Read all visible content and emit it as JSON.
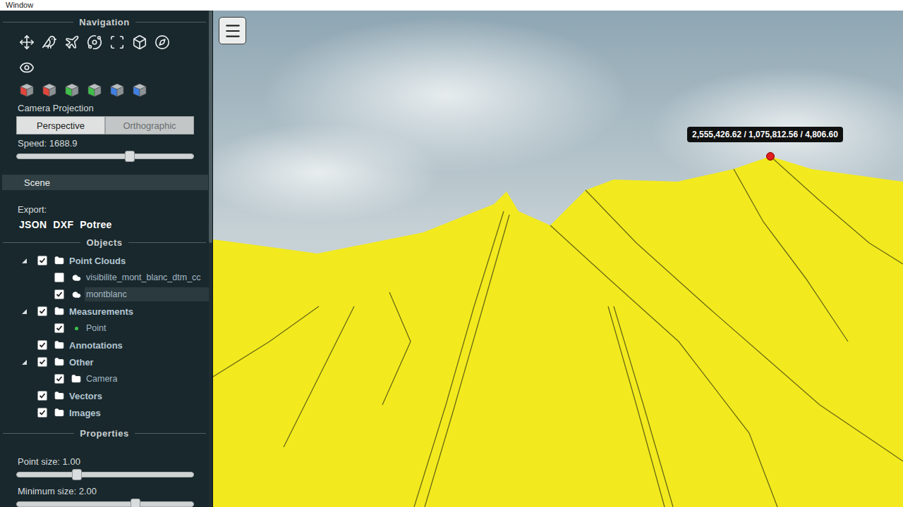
{
  "window": {
    "title": "Window"
  },
  "navigation": {
    "title": "Navigation",
    "view_cubes": [
      {
        "color": "#e0453c"
      },
      {
        "color": "#e0453c"
      },
      {
        "color": "#3fbf4a"
      },
      {
        "color": "#3fbf4a"
      },
      {
        "color": "#3f7fe0"
      },
      {
        "color": "#3f7fe0"
      }
    ],
    "camera_projection": {
      "label": "Camera Projection",
      "options": [
        {
          "label": "Perspective",
          "selected": true
        },
        {
          "label": "Orthographic",
          "selected": false
        }
      ]
    },
    "speed": {
      "label": "Speed: 1688.9",
      "level": 0.64
    }
  },
  "scene": {
    "title": "Scene",
    "export_label": "Export:",
    "export_formats": [
      "JSON",
      "DXF",
      "Potree"
    ]
  },
  "objects": {
    "title": "Objects",
    "tree": [
      {
        "label": "Point Clouds",
        "kind": "folder",
        "checked": true,
        "expanded": true,
        "selected": false,
        "children": [
          {
            "label": "visibilite_mont_blanc_dtm_cc",
            "kind": "pointcloud",
            "checked": false,
            "expanded": false,
            "selected": false,
            "children": []
          },
          {
            "label": "montblanc",
            "kind": "pointcloud",
            "checked": true,
            "expanded": false,
            "selected": true,
            "children": []
          }
        ]
      },
      {
        "label": "Measurements",
        "kind": "folder",
        "checked": true,
        "expanded": true,
        "selected": false,
        "children": [
          {
            "label": "Point",
            "kind": "point",
            "checked": true,
            "expanded": false,
            "selected": false,
            "children": []
          }
        ]
      },
      {
        "label": "Annotations",
        "kind": "folder",
        "checked": true,
        "expanded": false,
        "selected": false,
        "children": []
      },
      {
        "label": "Other",
        "kind": "folder",
        "checked": true,
        "expanded": true,
        "selected": false,
        "children": [
          {
            "label": "Camera",
            "kind": "folder",
            "checked": true,
            "expanded": false,
            "selected": false,
            "children": []
          }
        ]
      },
      {
        "label": "Vectors",
        "kind": "folder",
        "checked": true,
        "expanded": false,
        "selected": false,
        "children": []
      },
      {
        "label": "Images",
        "kind": "folder",
        "checked": true,
        "expanded": false,
        "selected": false,
        "children": []
      }
    ]
  },
  "properties": {
    "title": "Properties",
    "sliders": [
      {
        "label": "Point size: 1.00",
        "level": 0.34
      },
      {
        "label": "Minimum size: 2.00",
        "level": 0.67
      }
    ]
  },
  "viewer": {
    "measurement_label": "2,555,426.62 / 1,075,812.56 / 4,806.60"
  }
}
